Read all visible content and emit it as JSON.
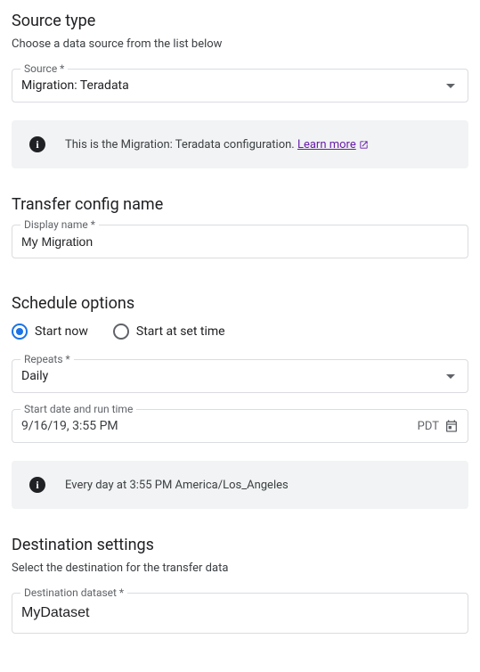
{
  "sourceType": {
    "title": "Source type",
    "subtitle": "Choose a data source from the list below",
    "sourceLabel": "Source *",
    "sourceValue": "Migration: Teradata",
    "bannerText": "This is the Migration: Teradata configuration. ",
    "learnMore": "Learn more"
  },
  "transferConfig": {
    "title": "Transfer config name",
    "displayNameLabel": "Display name *",
    "displayNameValue": "My Migration"
  },
  "scheduleOptions": {
    "title": "Schedule options",
    "startNowLabel": "Start now",
    "startAtSetTimeLabel": "Start at set time",
    "selected": "startNow",
    "repeatsLabel": "Repeats *",
    "repeatsValue": "Daily",
    "startDateLabel": "Start date and run time",
    "startDateValue": "9/16/19, 3:55 PM",
    "tz": "PDT",
    "bannerText": "Every day at 3:55 PM America/Los_Angeles"
  },
  "destination": {
    "title": "Destination settings",
    "subtitle": "Select the destination for the transfer data",
    "datasetLabel": "Destination dataset *",
    "datasetValue": "MyDataset"
  }
}
